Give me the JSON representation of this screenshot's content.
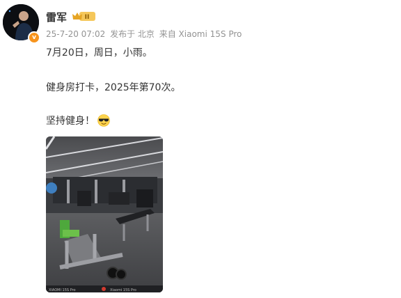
{
  "author": {
    "name": "雷军",
    "vip_badge_text": "II"
  },
  "meta": {
    "time": "25-7-20 07:02",
    "location": "发布于 北京",
    "source": "来自 Xiaomi 15S Pro"
  },
  "content": {
    "line1": "7月20日，周日，小雨。",
    "line2": "健身房打卡，2025年第70次。",
    "line3": "坚持健身！"
  },
  "icons": {
    "avatar": "avatar-photo",
    "verify": "verified-icon",
    "vip": "vip-crown-icon",
    "emoji": "sunglasses-emoji-icon"
  },
  "colors": {
    "verify": "#f7941d",
    "vip": "#f0b43c",
    "meta_text": "#939393"
  },
  "photo": {
    "left_caption": "XIAOMI 15S Pro",
    "right_caption": "Xiaomi 15S Pro"
  }
}
